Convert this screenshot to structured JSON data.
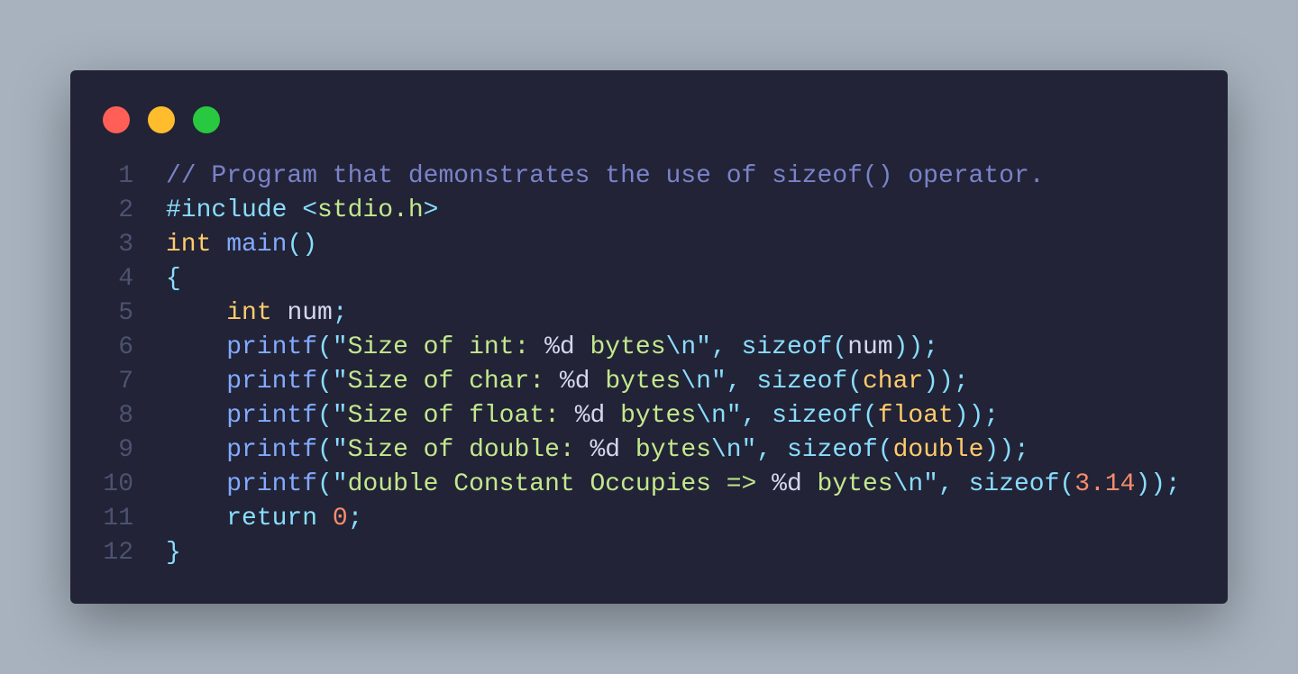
{
  "window": {
    "controls": [
      {
        "name": "close",
        "color": "#ff5f57"
      },
      {
        "name": "minimize",
        "color": "#ffbd2e"
      },
      {
        "name": "maximize",
        "color": "#28c840"
      }
    ]
  },
  "code": {
    "language": "c",
    "lines": [
      {
        "number": "1",
        "tokens": [
          {
            "t": "comment",
            "text": "// Program that demonstrates the use of sizeof() operator."
          }
        ]
      },
      {
        "number": "2",
        "tokens": [
          {
            "t": "pre",
            "text": "#include"
          },
          {
            "t": "ws",
            "text": " "
          },
          {
            "t": "punct",
            "text": "<"
          },
          {
            "t": "header",
            "text": "stdio.h"
          },
          {
            "t": "punct",
            "text": ">"
          }
        ]
      },
      {
        "number": "3",
        "tokens": [
          {
            "t": "type",
            "text": "int"
          },
          {
            "t": "ws",
            "text": " "
          },
          {
            "t": "func",
            "text": "main"
          },
          {
            "t": "punct",
            "text": "()"
          }
        ]
      },
      {
        "number": "4",
        "tokens": [
          {
            "t": "punct",
            "text": "{"
          }
        ]
      },
      {
        "number": "5",
        "tokens": [
          {
            "t": "ws",
            "text": "    "
          },
          {
            "t": "type",
            "text": "int"
          },
          {
            "t": "ws",
            "text": " "
          },
          {
            "t": "var",
            "text": "num"
          },
          {
            "t": "punct",
            "text": ";"
          }
        ]
      },
      {
        "number": "6",
        "tokens": [
          {
            "t": "ws",
            "text": "    "
          },
          {
            "t": "func",
            "text": "printf"
          },
          {
            "t": "punct",
            "text": "(\""
          },
          {
            "t": "string",
            "text": "Size of int: "
          },
          {
            "t": "format",
            "text": "%d"
          },
          {
            "t": "string",
            "text": " bytes"
          },
          {
            "t": "punct",
            "text": "\\n\", "
          },
          {
            "t": "kw",
            "text": "sizeof"
          },
          {
            "t": "punct",
            "text": "("
          },
          {
            "t": "var",
            "text": "num"
          },
          {
            "t": "punct",
            "text": "));"
          }
        ]
      },
      {
        "number": "7",
        "tokens": [
          {
            "t": "ws",
            "text": "    "
          },
          {
            "t": "func",
            "text": "printf"
          },
          {
            "t": "punct",
            "text": "(\""
          },
          {
            "t": "string",
            "text": "Size of char: "
          },
          {
            "t": "format",
            "text": "%d"
          },
          {
            "t": "string",
            "text": " bytes"
          },
          {
            "t": "punct",
            "text": "\\n\", "
          },
          {
            "t": "kw",
            "text": "sizeof"
          },
          {
            "t": "punct",
            "text": "("
          },
          {
            "t": "type",
            "text": "char"
          },
          {
            "t": "punct",
            "text": "));"
          }
        ]
      },
      {
        "number": "8",
        "tokens": [
          {
            "t": "ws",
            "text": "    "
          },
          {
            "t": "func",
            "text": "printf"
          },
          {
            "t": "punct",
            "text": "(\""
          },
          {
            "t": "string",
            "text": "Size of float: "
          },
          {
            "t": "format",
            "text": "%d"
          },
          {
            "t": "string",
            "text": " bytes"
          },
          {
            "t": "punct",
            "text": "\\n\", "
          },
          {
            "t": "kw",
            "text": "sizeof"
          },
          {
            "t": "punct",
            "text": "("
          },
          {
            "t": "type",
            "text": "float"
          },
          {
            "t": "punct",
            "text": "));"
          }
        ]
      },
      {
        "number": "9",
        "tokens": [
          {
            "t": "ws",
            "text": "    "
          },
          {
            "t": "func",
            "text": "printf"
          },
          {
            "t": "punct",
            "text": "(\""
          },
          {
            "t": "string",
            "text": "Size of double: "
          },
          {
            "t": "format",
            "text": "%d"
          },
          {
            "t": "string",
            "text": " bytes"
          },
          {
            "t": "punct",
            "text": "\\n\", "
          },
          {
            "t": "kw",
            "text": "sizeof"
          },
          {
            "t": "punct",
            "text": "("
          },
          {
            "t": "type",
            "text": "double"
          },
          {
            "t": "punct",
            "text": "));"
          }
        ]
      },
      {
        "number": "10",
        "tokens": [
          {
            "t": "ws",
            "text": "    "
          },
          {
            "t": "func",
            "text": "printf"
          },
          {
            "t": "punct",
            "text": "(\""
          },
          {
            "t": "string",
            "text": "double Constant Occupies => "
          },
          {
            "t": "format",
            "text": "%d"
          },
          {
            "t": "string",
            "text": " bytes"
          },
          {
            "t": "punct",
            "text": "\\n\", "
          },
          {
            "t": "kw",
            "text": "sizeof"
          },
          {
            "t": "punct",
            "text": "("
          },
          {
            "t": "num",
            "text": "3.14"
          },
          {
            "t": "punct",
            "text": "));"
          }
        ]
      },
      {
        "number": "11",
        "tokens": [
          {
            "t": "ws",
            "text": "    "
          },
          {
            "t": "kw",
            "text": "return"
          },
          {
            "t": "ws",
            "text": " "
          },
          {
            "t": "num",
            "text": "0"
          },
          {
            "t": "punct",
            "text": ";"
          }
        ]
      },
      {
        "number": "12",
        "tokens": [
          {
            "t": "punct",
            "text": "}"
          }
        ]
      }
    ]
  }
}
